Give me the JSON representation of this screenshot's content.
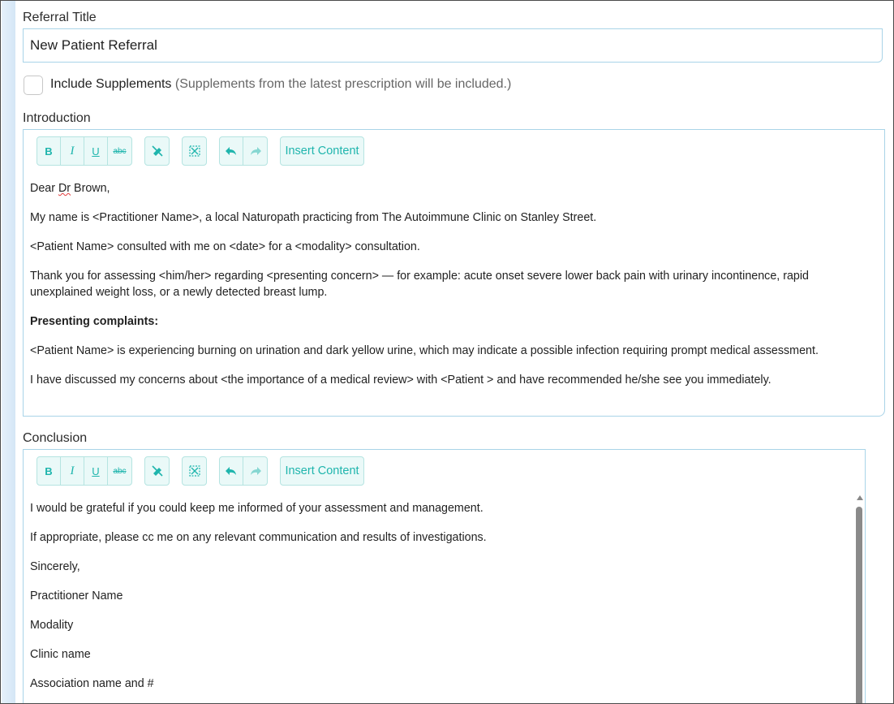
{
  "referral": {
    "title_label": "Referral Title",
    "title_value": "New Patient Referral",
    "supplements_label": "Include Supplements",
    "supplements_note": "(Supplements from the latest prescription will be included.)",
    "supplements_checked": false
  },
  "toolbar": {
    "bold": "B",
    "italic": "I",
    "underline": "U",
    "strikethrough": "abc",
    "insert_content": "Insert Content",
    "icons": [
      "bold-icon",
      "italic-icon",
      "underline-icon",
      "strikethrough-icon",
      "clear-format-icon",
      "fullscreen-icon",
      "undo-icon",
      "redo-icon"
    ],
    "accent_color": "#1fb5ad"
  },
  "introduction": {
    "label": "Introduction",
    "greeting_prefix": "Dear ",
    "greeting_misspelled": "Dr",
    "greeting_suffix": " Brown,",
    "p1": "My name is <Practitioner Name>, a local Naturopath practicing from The Autoimmune Clinic on Stanley Street.",
    "p2": "<Patient Name> consulted with me on <date> for a <modality> consultation.",
    "p3": "Thank you for assessing <him/her>  regarding <presenting concern> — for example: acute onset severe lower back pain with urinary incontinence, rapid unexplained weight loss, or a newly detected breast lump.",
    "p4_heading": "Presenting complaints:",
    "p5": "<Patient Name> is experiencing burning on urination and dark yellow urine, which may indicate a possible infection requiring prompt medical assessment.",
    "p6": "I have discussed my concerns about <the importance of a medical review> with <Patient > and have recommended he/she see you immediately."
  },
  "conclusion": {
    "label": "Conclusion",
    "lines": [
      "I would be grateful if you could keep me informed of your assessment and management.",
      "If appropriate, please cc me on any relevant communication and results of investigations.",
      "Sincerely,",
      "Practitioner Name",
      "Modality",
      "Clinic name",
      "Association name and #"
    ]
  }
}
